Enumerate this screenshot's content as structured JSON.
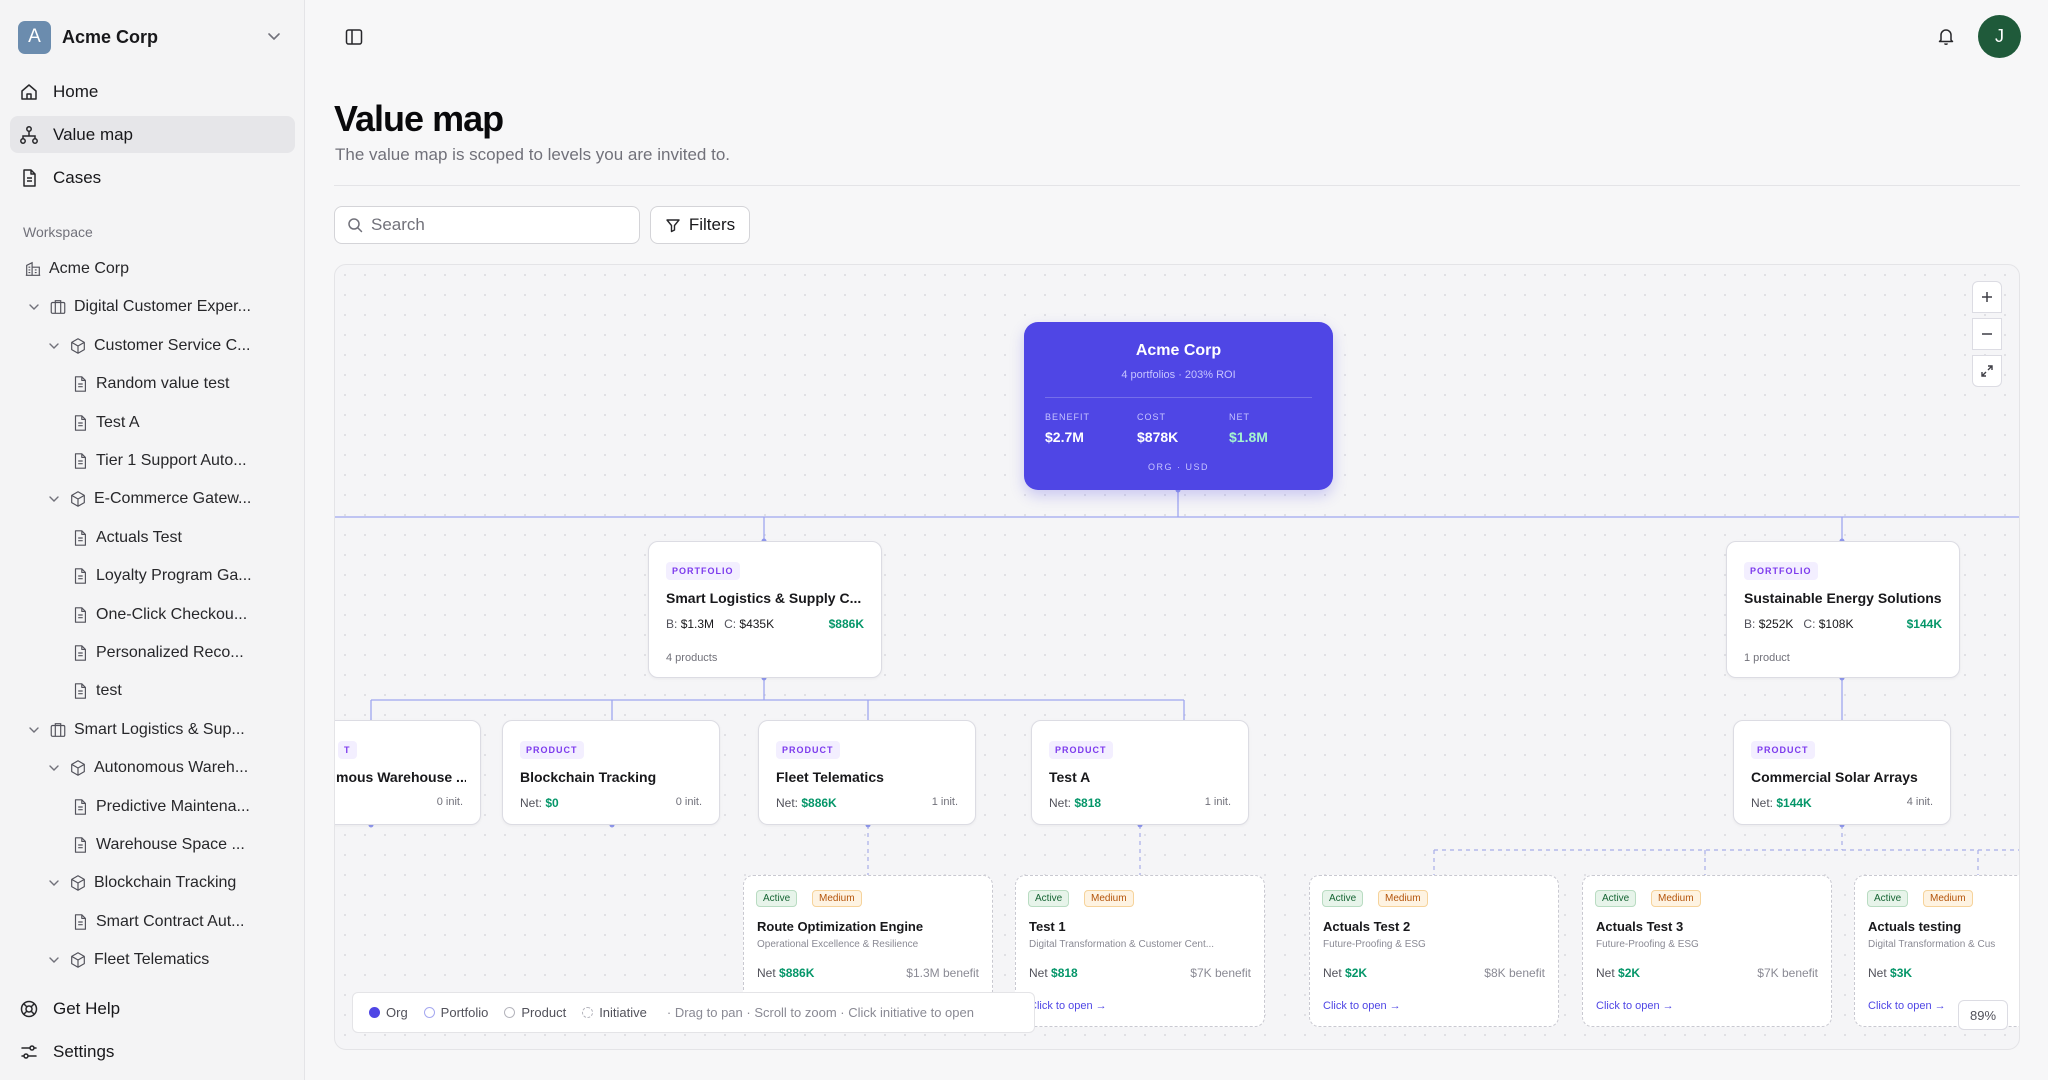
{
  "org": {
    "initial": "A",
    "name": "Acme Corp"
  },
  "nav": [
    {
      "label": "Home",
      "icon": "home-icon"
    },
    {
      "label": "Value map",
      "icon": "sitemap-icon",
      "active": true
    },
    {
      "label": "Cases",
      "icon": "document-icon"
    }
  ],
  "workspace": {
    "label": "Workspace",
    "tree": [
      {
        "label": "Acme Corp",
        "type": "org"
      },
      {
        "label": "Digital Customer Exper...",
        "type": "portfolio"
      },
      {
        "label": "Customer Service C...",
        "type": "product"
      },
      {
        "label": "Random value test",
        "type": "case"
      },
      {
        "label": "Test A",
        "type": "case"
      },
      {
        "label": "Tier 1 Support Auto...",
        "type": "case"
      },
      {
        "label": "E-Commerce Gatew...",
        "type": "product"
      },
      {
        "label": "Actuals Test",
        "type": "case"
      },
      {
        "label": "Loyalty Program Ga...",
        "type": "case"
      },
      {
        "label": "One-Click Checkou...",
        "type": "case"
      },
      {
        "label": "Personalized Reco...",
        "type": "case"
      },
      {
        "label": "test",
        "type": "case"
      },
      {
        "label": "Smart Logistics & Sup...",
        "type": "portfolio"
      },
      {
        "label": "Autonomous Wareh...",
        "type": "product"
      },
      {
        "label": "Predictive Maintena...",
        "type": "case"
      },
      {
        "label": "Warehouse Space ...",
        "type": "case"
      },
      {
        "label": "Blockchain Tracking",
        "type": "product"
      },
      {
        "label": "Smart Contract Aut...",
        "type": "case"
      },
      {
        "label": "Fleet Telematics",
        "type": "product"
      }
    ]
  },
  "bottom_nav": [
    {
      "label": "Get Help",
      "icon": "help-icon"
    },
    {
      "label": "Settings",
      "icon": "settings-icon"
    }
  ],
  "user": {
    "initial": "J"
  },
  "page": {
    "title": "Value map",
    "subtitle": "The value map is scoped to levels you are invited to.",
    "search_placeholder": "Search",
    "filters_label": "Filters"
  },
  "map": {
    "org_card": {
      "title": "Acme Corp",
      "subtitle": "4 portfolios · 203% ROI",
      "benefit_label": "BENEFIT",
      "benefit": "$2.7M",
      "cost_label": "COST",
      "cost": "$878K",
      "net_label": "NET",
      "net": "$1.8M",
      "footer": "ORG · USD"
    },
    "portfolios": [
      {
        "badge": "PORTFOLIO",
        "title": "Smart Logistics & Supply C...",
        "b_label": "B:",
        "benefit": "$1.3M",
        "c_label": "C:",
        "cost": "$435K",
        "net": "$886K",
        "count": "4 products"
      },
      {
        "badge": "PORTFOLIO",
        "title": "Sustainable Energy Solutions",
        "b_label": "B:",
        "benefit": "$252K",
        "c_label": "C:",
        "cost": "$108K",
        "net": "$144K",
        "count": "1 product"
      }
    ],
    "products": [
      {
        "badge": "T",
        "title": "mous Warehouse ...",
        "net_label": "",
        "net": "",
        "inits": "0 init."
      },
      {
        "badge": "PRODUCT",
        "title": "Blockchain Tracking",
        "net_label": "Net:",
        "net": "$0",
        "inits": "0 init."
      },
      {
        "badge": "PRODUCT",
        "title": "Fleet Telematics",
        "net_label": "Net:",
        "net": "$886K",
        "inits": "1 init."
      },
      {
        "badge": "PRODUCT",
        "title": "Test A",
        "net_label": "Net:",
        "net": "$818",
        "inits": "1 init."
      },
      {
        "badge": "PRODUCT",
        "title": "Commercial Solar Arrays",
        "net_label": "Net:",
        "net": "$144K",
        "inits": "4 init."
      }
    ],
    "initiatives": [
      {
        "status": "Active",
        "priority": "Medium",
        "title": "Route Optimization Engine",
        "theme": "Operational Excellence & Resilience",
        "net_label": "Net",
        "net": "$886K",
        "benefit": "$1.3M benefit",
        "link": ""
      },
      {
        "status": "Active",
        "priority": "Medium",
        "title": "Test 1",
        "theme": "Digital Transformation & Customer Cent...",
        "net_label": "Net",
        "net": "$818",
        "benefit": "$7K benefit",
        "link": "Click to open →"
      },
      {
        "status": "Active",
        "priority": "Medium",
        "title": "Actuals Test 2",
        "theme": "Future-Proofing & ESG",
        "net_label": "Net",
        "net": "$2K",
        "benefit": "$8K benefit",
        "link": "Click to open →"
      },
      {
        "status": "Active",
        "priority": "Medium",
        "title": "Actuals Test 3",
        "theme": "Future-Proofing & ESG",
        "net_label": "Net",
        "net": "$2K",
        "benefit": "$7K benefit",
        "link": "Click to open →"
      },
      {
        "status": "Active",
        "priority": "Medium",
        "title": "Actuals testing",
        "theme": "Digital Transformation & Cus",
        "net_label": "Net",
        "net": "$3K",
        "benefit": "",
        "link": "Click to open →"
      }
    ],
    "legend": {
      "org": "Org",
      "portfolio": "Portfolio",
      "product": "Product",
      "initiative": "Initiative",
      "hint": "· Drag to pan · Scroll to zoom · Click initiative to open"
    },
    "zoom_level": "89%",
    "colors": {
      "accent": "#4f46e5",
      "positive": "#059669",
      "badge": "#7c3aed"
    }
  }
}
